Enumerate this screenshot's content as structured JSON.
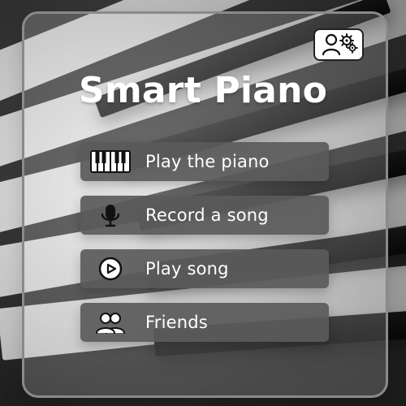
{
  "app": {
    "title": "Smart Piano"
  },
  "menu": {
    "items": [
      {
        "label": "Play the piano",
        "icon": "piano-keys-icon"
      },
      {
        "label": "Record a song",
        "icon": "microphone-icon"
      },
      {
        "label": "Play song",
        "icon": "play-circle-icon"
      },
      {
        "label": "Friends",
        "icon": "friends-icon"
      }
    ]
  },
  "header": {
    "settings_icon": "user-settings-icon"
  },
  "colors": {
    "menu_item_bg": "#5a5a5a",
    "text": "#ffffff",
    "card_border": "#8a8a8a"
  }
}
